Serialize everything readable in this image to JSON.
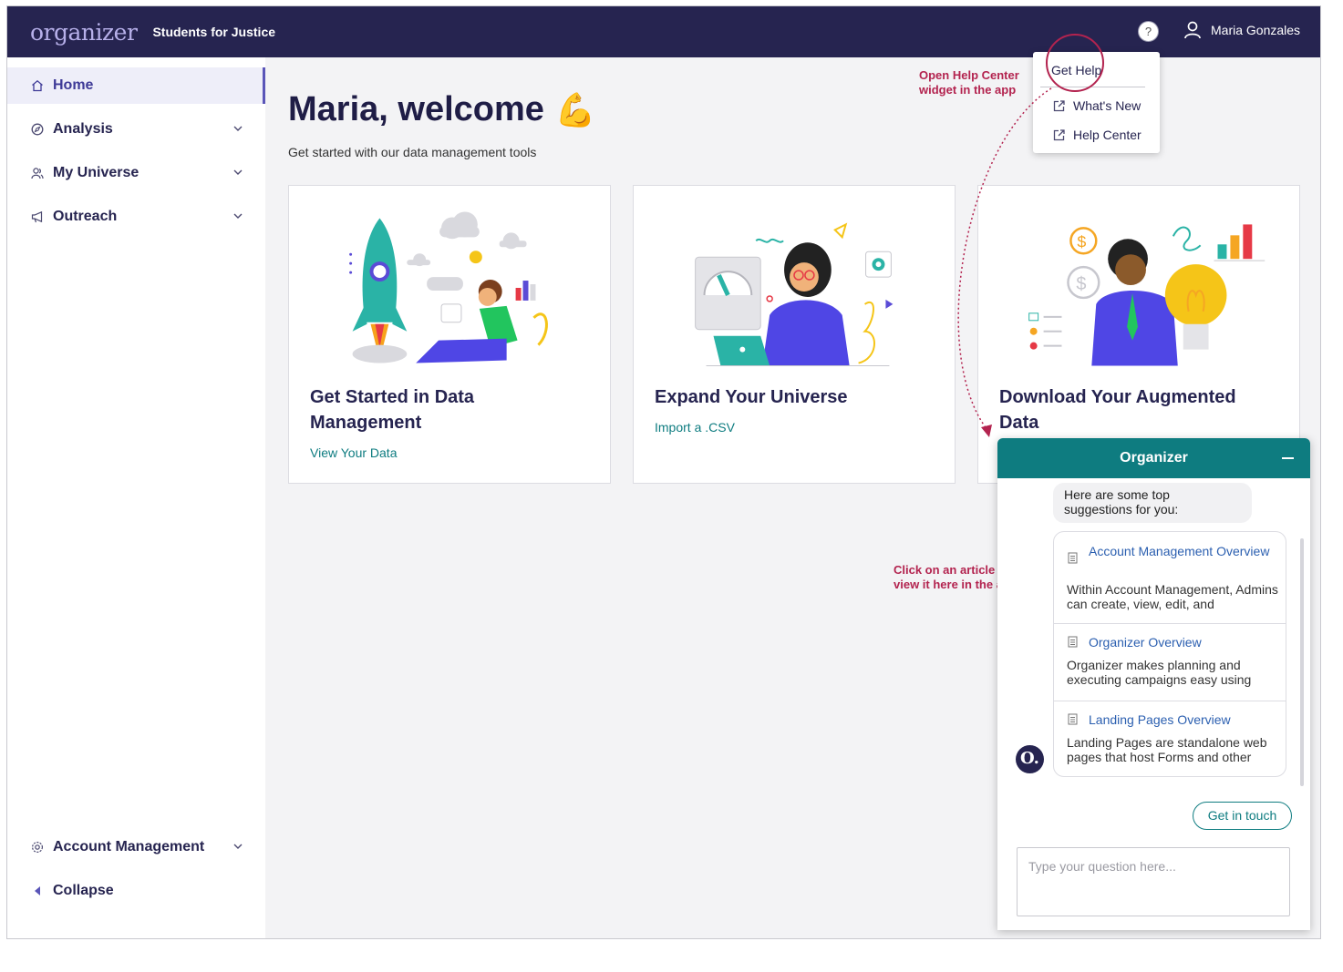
{
  "header": {
    "logo": "organizer",
    "org_name": "Students for Justice",
    "help_icon": "question-icon",
    "help_glyph": "?",
    "user_name": "Maria Gonzales"
  },
  "sidebar": {
    "items": [
      {
        "label": "Home",
        "icon": "home-icon",
        "active": true
      },
      {
        "label": "Analysis",
        "icon": "compass-icon"
      },
      {
        "label": "My Universe",
        "icon": "people-icon"
      },
      {
        "label": "Outreach",
        "icon": "megaphone-icon"
      }
    ],
    "account_management": "Account Management",
    "collapse": "Collapse"
  },
  "main": {
    "welcome": "Maria, welcome",
    "welcome_emoji": "💪",
    "subtitle": "Get started with our data management tools",
    "cards": [
      {
        "title": "Get Started in Data Management",
        "link": "View Your Data"
      },
      {
        "title": "Expand Your Universe",
        "link": "Import a .CSV"
      },
      {
        "title": "Download Your Augmented Data",
        "link": ""
      }
    ]
  },
  "help_menu": {
    "get_help": "Get Help",
    "whats_new": "What's New",
    "help_center": "Help Center"
  },
  "annotations": {
    "open_help": "Open Help Center widget in the app",
    "click_article": "Click on an article to view it here in the app"
  },
  "chat": {
    "title": "Organizer",
    "greeting": "Here are some top suggestions for you:",
    "avatar_letter": "O.",
    "articles": [
      {
        "title": "Account Management Overview",
        "desc": "Within Account Management, Admins can create, view, edit, and"
      },
      {
        "title": "Organizer Overview",
        "desc": "Organizer makes planning and executing campaigns easy using"
      },
      {
        "title": "Landing Pages Overview",
        "desc": "Landing Pages are standalone web pages that host Forms and other"
      }
    ],
    "get_in_touch": "Get in touch",
    "input_placeholder": "Type your question here..."
  },
  "colors": {
    "brand_navy": "#262450",
    "teal": "#0e7c80",
    "annotation_red": "#b3234f",
    "link_blue": "#2b5fb0"
  }
}
